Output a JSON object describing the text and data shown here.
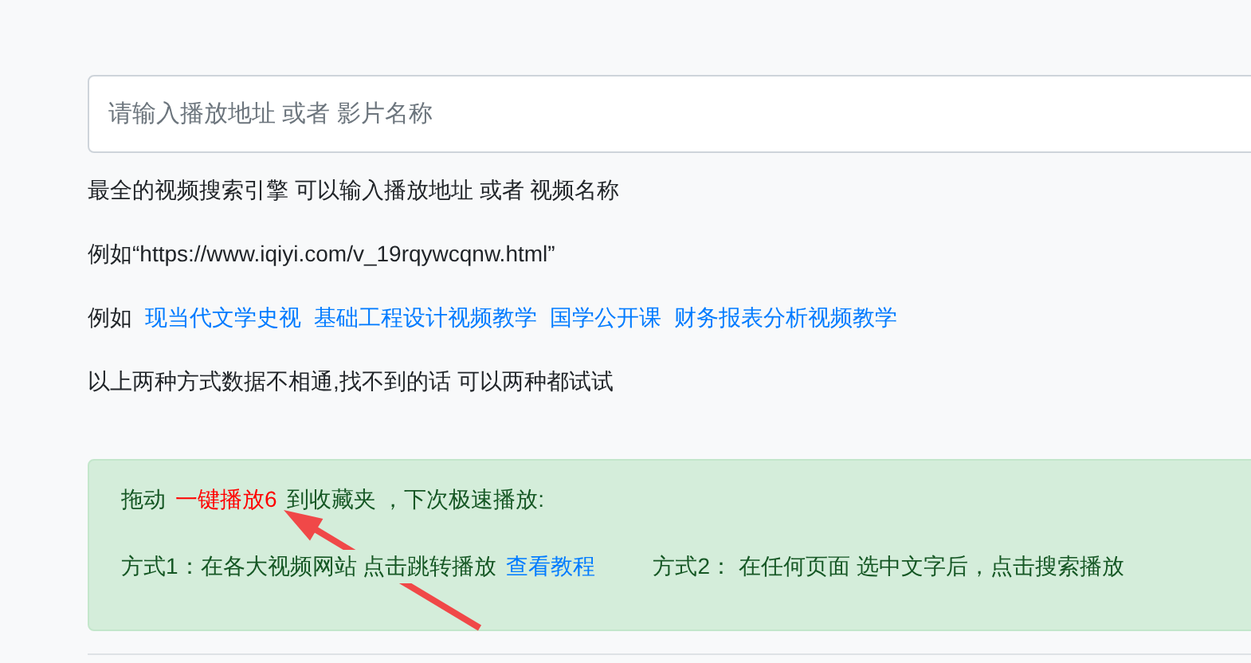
{
  "search": {
    "placeholder": "请输入播放地址 或者 影片名称"
  },
  "intro": "最全的视频搜索引擎 可以输入播放地址 或者 视频名称",
  "example_url": "例如“https://www.iqiyi.com/v_19rqywcqnw.html”",
  "examples": {
    "label": "例如",
    "links": [
      "现当代文学史视",
      "基础工程设计视频教学",
      "国学公开课",
      "财务报表分析视频教学"
    ]
  },
  "note": "以上两种方式数据不相通,找不到的话 可以两种都试试",
  "bookmark": {
    "before": "拖动",
    "link": "一键播放6",
    "after": "到收藏夹 ，下次极速播放:",
    "method1": {
      "text": "方式1：在各大视频网站 点击跳转播放",
      "link": "查看教程"
    },
    "method2": {
      "text": "方式2： 在任何页面 选中文字后，点击搜索播放"
    }
  }
}
